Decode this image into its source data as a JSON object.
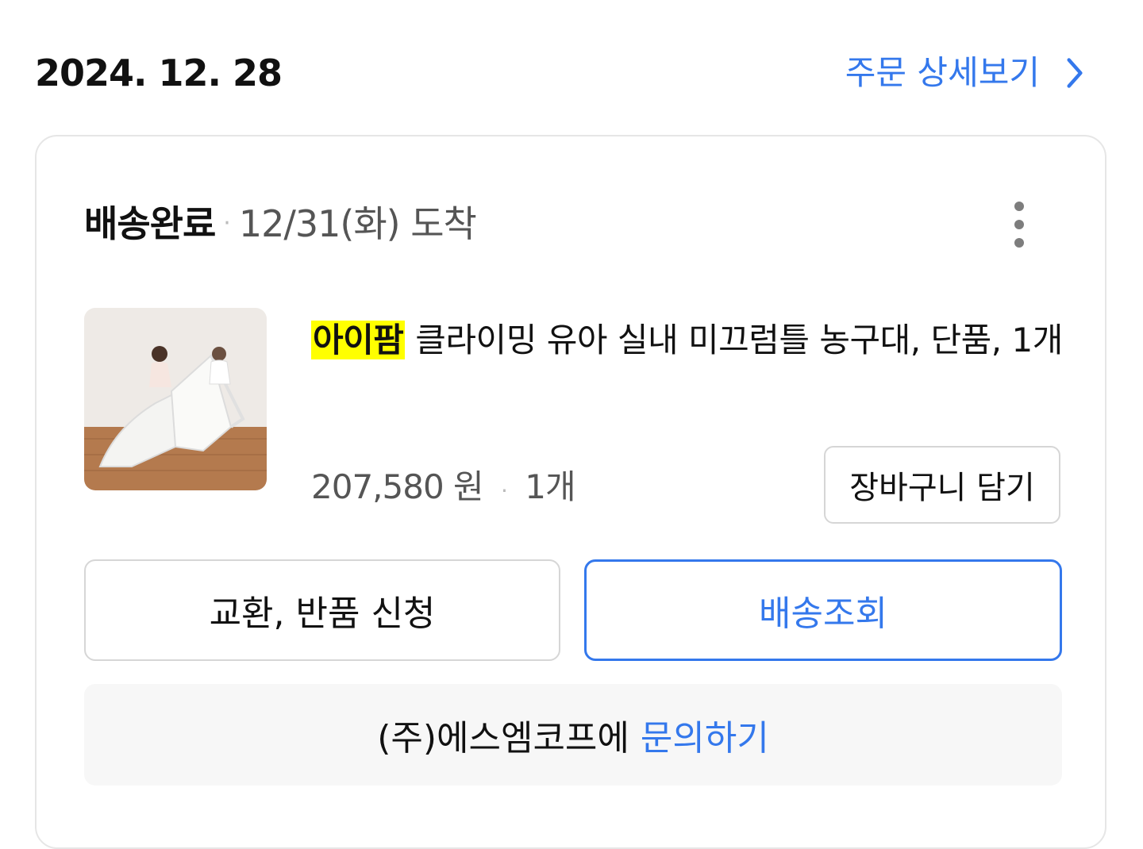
{
  "order": {
    "date": "2024. 12. 28",
    "detail_link_label": "주문 상세보기"
  },
  "shipment": {
    "status": "배송완료",
    "separator": "·",
    "arrival": "12/31(화) 도착"
  },
  "product": {
    "brand": "아이팜",
    "name": "클라이밍 유아 실내 미끄럼틀 농구대, 단품, 1개",
    "price": "207,580 원",
    "separator": "·",
    "quantity": "1개",
    "image_alt": "product-thumbnail"
  },
  "actions": {
    "cart_label": "장바구니 담기",
    "exchange_return_label": "교환, 반품 신청",
    "tracking_label": "배송조회"
  },
  "inquiry": {
    "seller": "(주)에스엠코프에",
    "link_label": "문의하기"
  },
  "colors": {
    "accent": "#3478ec",
    "brand_highlight": "#ffff00"
  }
}
